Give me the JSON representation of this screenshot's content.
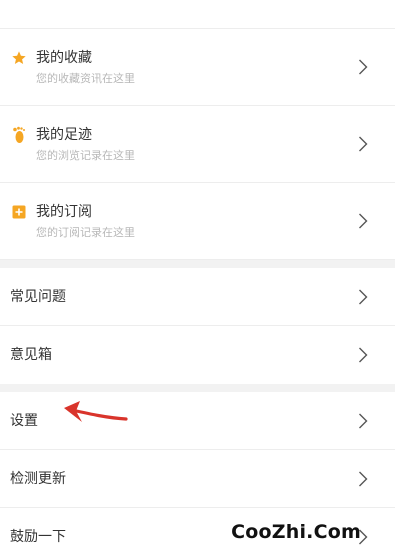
{
  "menu_group_1": [
    {
      "title": "我的收藏",
      "subtitle": "您的收藏资讯在这里",
      "icon": "star-icon"
    },
    {
      "title": "我的足迹",
      "subtitle": "您的浏览记录在这里",
      "icon": "footprint-icon"
    },
    {
      "title": "我的订阅",
      "subtitle": "您的订阅记录在这里",
      "icon": "subscribe-icon"
    }
  ],
  "menu_group_2": [
    {
      "title": "常见问题"
    },
    {
      "title": "意见箱"
    }
  ],
  "menu_group_3": [
    {
      "title": "设置"
    },
    {
      "title": "检测更新"
    },
    {
      "title": "鼓励一下"
    }
  ],
  "watermark": "CooZhi.Com",
  "colors": {
    "icon_orange": "#f5a623",
    "annotation_red": "#d9342b",
    "separator": "#f2f2f2",
    "chevron": "#555555"
  }
}
